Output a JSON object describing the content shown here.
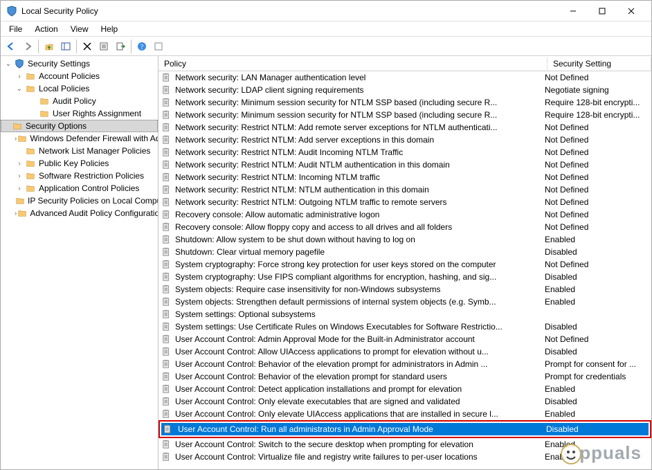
{
  "window": {
    "title": "Local Security Policy"
  },
  "menus": [
    "File",
    "Action",
    "View",
    "Help"
  ],
  "tree": {
    "root": "Security Settings",
    "nodes": [
      {
        "label": "Account Policies",
        "depth": 1,
        "exp": "›"
      },
      {
        "label": "Local Policies",
        "depth": 1,
        "exp": "⌄"
      },
      {
        "label": "Audit Policy",
        "depth": 2,
        "exp": ""
      },
      {
        "label": "User Rights Assignment",
        "depth": 2,
        "exp": ""
      },
      {
        "label": "Security Options",
        "depth": 2,
        "exp": "",
        "selected": true
      },
      {
        "label": "Windows Defender Firewall with Advanced Security",
        "depth": 1,
        "exp": "›"
      },
      {
        "label": "Network List Manager Policies",
        "depth": 1,
        "exp": ""
      },
      {
        "label": "Public Key Policies",
        "depth": 1,
        "exp": "›"
      },
      {
        "label": "Software Restriction Policies",
        "depth": 1,
        "exp": "›"
      },
      {
        "label": "Application Control Policies",
        "depth": 1,
        "exp": "›"
      },
      {
        "label": "IP Security Policies on Local Computer",
        "depth": 1,
        "exp": ""
      },
      {
        "label": "Advanced Audit Policy Configuration",
        "depth": 1,
        "exp": "›"
      }
    ]
  },
  "list": {
    "headers": {
      "policy": "Policy",
      "setting": "Security Setting"
    },
    "rows": [
      {
        "p": "Network security: LAN Manager authentication level",
        "s": "Not Defined"
      },
      {
        "p": "Network security: LDAP client signing requirements",
        "s": "Negotiate signing"
      },
      {
        "p": "Network security: Minimum session security for NTLM SSP based (including secure R...",
        "s": "Require 128-bit encrypti..."
      },
      {
        "p": "Network security: Minimum session security for NTLM SSP based (including secure R...",
        "s": "Require 128-bit encrypti..."
      },
      {
        "p": "Network security: Restrict NTLM: Add remote server exceptions for NTLM authenticati...",
        "s": "Not Defined"
      },
      {
        "p": "Network security: Restrict NTLM: Add server exceptions in this domain",
        "s": "Not Defined"
      },
      {
        "p": "Network security: Restrict NTLM: Audit Incoming NTLM Traffic",
        "s": "Not Defined"
      },
      {
        "p": "Network security: Restrict NTLM: Audit NTLM authentication in this domain",
        "s": "Not Defined"
      },
      {
        "p": "Network security: Restrict NTLM: Incoming NTLM traffic",
        "s": "Not Defined"
      },
      {
        "p": "Network security: Restrict NTLM: NTLM authentication in this domain",
        "s": "Not Defined"
      },
      {
        "p": "Network security: Restrict NTLM: Outgoing NTLM traffic to remote servers",
        "s": "Not Defined"
      },
      {
        "p": "Recovery console: Allow automatic administrative logon",
        "s": "Not Defined"
      },
      {
        "p": "Recovery console: Allow floppy copy and access to all drives and all folders",
        "s": "Not Defined"
      },
      {
        "p": "Shutdown: Allow system to be shut down without having to log on",
        "s": "Enabled"
      },
      {
        "p": "Shutdown: Clear virtual memory pagefile",
        "s": "Disabled"
      },
      {
        "p": "System cryptography: Force strong key protection for user keys stored on the computer",
        "s": "Not Defined"
      },
      {
        "p": "System cryptography: Use FIPS compliant algorithms for encryption, hashing, and sig...",
        "s": "Disabled"
      },
      {
        "p": "System objects: Require case insensitivity for non-Windows subsystems",
        "s": "Enabled"
      },
      {
        "p": "System objects: Strengthen default permissions of internal system objects (e.g. Symb...",
        "s": "Enabled"
      },
      {
        "p": "System settings: Optional subsystems",
        "s": ""
      },
      {
        "p": "System settings: Use Certificate Rules on Windows Executables for Software Restrictio...",
        "s": "Disabled"
      },
      {
        "p": "User Account Control: Admin Approval Mode for the Built-in Administrator account",
        "s": "Not Defined"
      },
      {
        "p": "User Account Control: Allow UIAccess applications to prompt for elevation without u...",
        "s": "Disabled"
      },
      {
        "p": "User Account Control: Behavior of the elevation prompt for administrators in Admin ...",
        "s": "Prompt for consent for ..."
      },
      {
        "p": "User Account Control: Behavior of the elevation prompt for standard users",
        "s": "Prompt for credentials"
      },
      {
        "p": "User Account Control: Detect application installations and prompt for elevation",
        "s": "Enabled"
      },
      {
        "p": "User Account Control: Only elevate executables that are signed and validated",
        "s": "Disabled"
      },
      {
        "p": "User Account Control: Only elevate UIAccess applications that are installed in secure l...",
        "s": "Enabled"
      },
      {
        "p": "User Account Control: Run all administrators in Admin Approval Mode",
        "s": "Disabled",
        "highlight": true
      },
      {
        "p": "User Account Control: Switch to the secure desktop when prompting for elevation",
        "s": "Enabled"
      },
      {
        "p": "User Account Control: Virtualize file and registry write failures to per-user locations",
        "s": "Enabled"
      }
    ]
  },
  "watermark": "ppuals"
}
